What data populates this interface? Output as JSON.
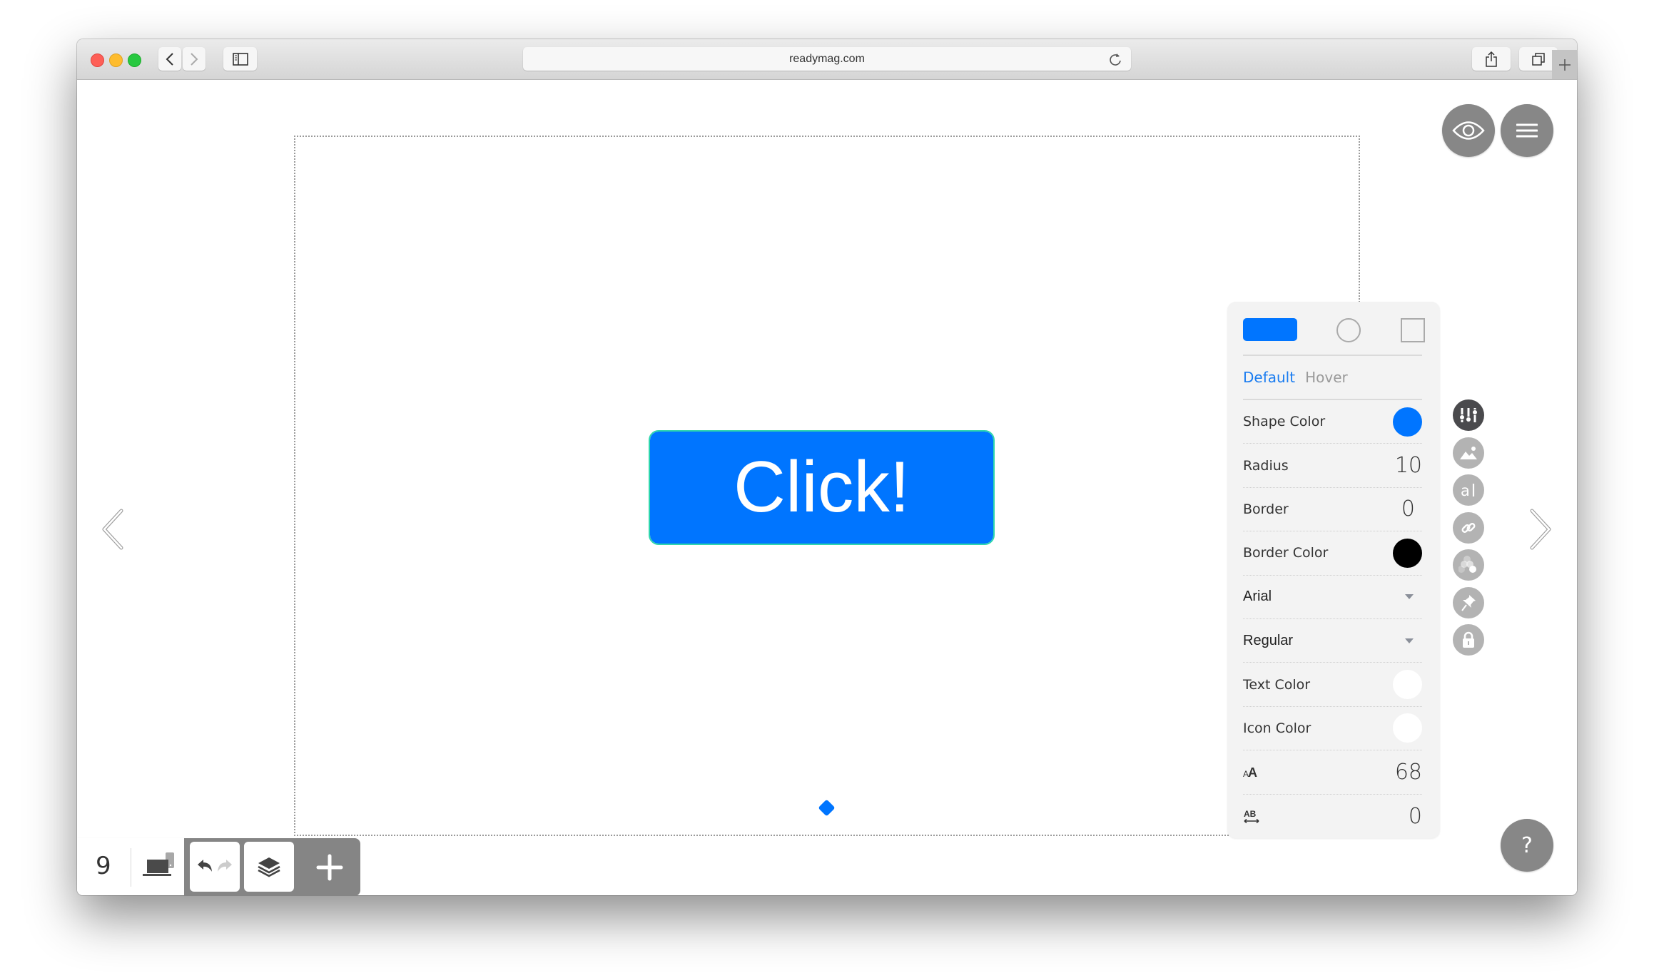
{
  "browser": {
    "url": "readymag.com",
    "traffic_lights": {
      "close": "#fe5f57",
      "minimize": "#febc2e",
      "zoom": "#28c840"
    },
    "icons": [
      "back-icon",
      "forward-icon",
      "sidebar-icon",
      "reload-icon",
      "share-icon",
      "tabs-icon",
      "new-tab-icon"
    ]
  },
  "canvas": {
    "button_text": "Click!",
    "button_color": "#0075ff",
    "selection_color": "#2fd6ae"
  },
  "top_actions": {
    "preview_icon": "eye-icon",
    "menu_icon": "hamburger-icon"
  },
  "panel": {
    "shape_options": [
      "rounded-rectangle",
      "circle",
      "square"
    ],
    "selected_shape": "rounded-rectangle",
    "state_tabs": [
      {
        "label": "Default",
        "active": true
      },
      {
        "label": "Hover",
        "active": false
      }
    ],
    "rows": {
      "shape_color": {
        "label": "Shape Color",
        "color": "#0075ff"
      },
      "radius": {
        "label": "Radius",
        "value": "10"
      },
      "border": {
        "label": "Border",
        "value": "0"
      },
      "border_color": {
        "label": "Border Color",
        "color": "#000000"
      },
      "font": {
        "label": "Arial"
      },
      "weight": {
        "label": "Regular"
      },
      "text_color": {
        "label": "Text Color",
        "color": "#ffffff"
      },
      "icon_color": {
        "label": "Icon Color",
        "color": "#ffffff"
      },
      "font_size": {
        "icon": "font-size-icon",
        "value": "68"
      },
      "letter_spacing": {
        "icon": "letter-spacing-icon",
        "value": "0"
      }
    }
  },
  "side_toolbar": [
    {
      "name": "settings",
      "icon": "sliders-icon",
      "active": true
    },
    {
      "name": "image",
      "icon": "image-icon",
      "active": false
    },
    {
      "name": "text",
      "icon": "text-icon",
      "active": false
    },
    {
      "name": "link",
      "icon": "link-icon",
      "active": false
    },
    {
      "name": "effects",
      "icon": "opacity-icon",
      "active": false
    },
    {
      "name": "pin",
      "icon": "pin-icon",
      "active": false
    },
    {
      "name": "lock",
      "icon": "lock-icon",
      "active": false
    }
  ],
  "bottom_bar": {
    "page_number": "9",
    "device_icon": "devices-icon",
    "undo_icon": "undo-icon",
    "redo_icon": "redo-icon",
    "layers_icon": "layers-icon",
    "add_icon": "plus-icon"
  },
  "help": {
    "label": "?"
  }
}
